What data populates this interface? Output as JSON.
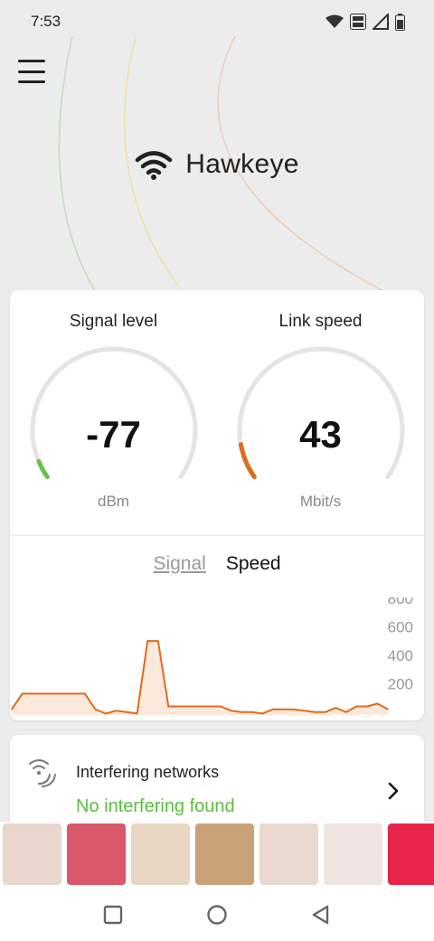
{
  "status_bar": {
    "time": "7:53",
    "icons": [
      "wifi-icon",
      "volte-icon",
      "cell-signal-icon",
      "battery-icon"
    ]
  },
  "header": {
    "app_title": "Hawkeye",
    "icons": [
      "menu-icon",
      "wifi-icon"
    ]
  },
  "signal_gauge": {
    "label": "Signal level",
    "value": "-77",
    "unit": "dBm",
    "level_fraction": 0.05,
    "color": "#6cc04a"
  },
  "speed_gauge": {
    "label": "Link speed",
    "value": "43",
    "unit": "Mbit/s",
    "level_fraction": 0.1,
    "color": "#e06a1b"
  },
  "chart_tabs": {
    "signal": "Signal",
    "speed": "Speed",
    "active": "Speed"
  },
  "chart_data": {
    "type": "area",
    "series": [
      {
        "values": [
          40,
          150,
          150,
          150,
          150,
          150,
          150,
          150,
          40,
          10,
          30,
          20,
          10,
          520,
          520,
          60,
          60,
          60,
          60,
          60,
          60,
          30,
          20,
          20,
          10,
          40,
          40,
          40,
          30,
          20,
          20,
          50,
          20,
          60,
          60,
          80,
          40
        ]
      }
    ],
    "y_ticks": [
      "800",
      "600",
      "400",
      "200"
    ],
    "ylim": [
      0,
      800
    ],
    "color": "#e06a1b",
    "fill": "#fde9dc"
  },
  "interfering": {
    "title": "Interfering networks",
    "status": "No interfering found",
    "status_color": "#5bbd3f"
  },
  "ad_banner": {
    "item_colors": [
      "#e9d6cc",
      "#d9586a",
      "#e8d7c2",
      "#c9a27a",
      "#ead9d0",
      "#f0e4e2",
      "#e8244a"
    ]
  },
  "nav_bar": {
    "icons": [
      "recent-apps-icon",
      "home-icon",
      "back-icon"
    ]
  },
  "colors": {
    "accent_orange": "#e06a1b",
    "accent_green": "#6cc04a"
  }
}
